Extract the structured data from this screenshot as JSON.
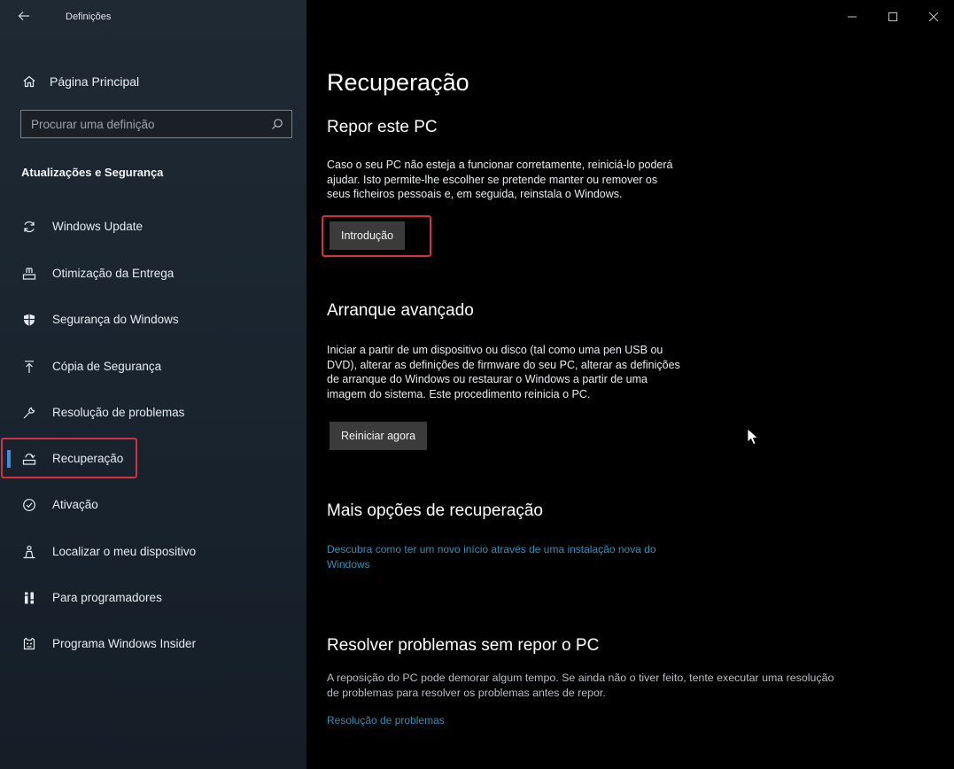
{
  "window": {
    "title": "Definições",
    "back_icon": "back-arrow-icon",
    "controls": [
      "minimize",
      "maximize",
      "close"
    ]
  },
  "sidebar": {
    "home_label": "Página Principal",
    "home_icon": "home-icon",
    "search": {
      "placeholder": "Procurar uma definição",
      "icon": "search-icon"
    },
    "section_title": "Atualizações e Segurança",
    "items": [
      {
        "label": "Windows Update",
        "icon": "sync-icon"
      },
      {
        "label": "Otimização da Entrega",
        "icon": "delivery-optimization-icon"
      },
      {
        "label": "Segurança do Windows",
        "icon": "shield-icon"
      },
      {
        "label": "Cópia de Segurança",
        "icon": "backup-arrow-icon"
      },
      {
        "label": "Resolução de problemas",
        "icon": "wrench-icon"
      },
      {
        "label": "Recuperação",
        "icon": "recovery-icon",
        "selected": true
      },
      {
        "label": "Ativação",
        "icon": "check-circle-icon"
      },
      {
        "label": "Localizar o meu dispositivo",
        "icon": "person-locate-icon"
      },
      {
        "label": "Para programadores",
        "icon": "developer-tools-icon"
      },
      {
        "label": "Programa Windows Insider",
        "icon": "insider-cat-icon"
      }
    ]
  },
  "main": {
    "page_title": "Recuperação",
    "reset": {
      "heading": "Repor este PC",
      "lines": [
        "Caso o seu PC não esteja a funcionar corretamente, reiniciá-lo poderá",
        "ajudar. Isto permite-lhe escolher se pretende manter ou remover os",
        "seus ficheiros pessoais e, em seguida, reinstala o Windows."
      ],
      "button": "Introdução"
    },
    "advanced": {
      "heading": "Arranque avançado",
      "lines": [
        "Iniciar a partir de um dispositivo ou disco (tal como uma pen USB ou",
        "DVD), alterar as definições de firmware do seu PC, alterar as definições",
        "de arranque do Windows ou restaurar o Windows a partir de uma",
        "imagem do sistema. Este procedimento reinicia o PC."
      ],
      "button": "Reiniciar agora"
    },
    "more": {
      "heading": "Mais opções de recuperação",
      "link_lines": [
        "Descubra como ter um novo início através de uma instalação nova do",
        "Windows"
      ]
    },
    "troubleshoot": {
      "heading": "Resolver problemas sem repor o PC",
      "lines": [
        "A reposição do PC pode demorar algum tempo. Se ainda não o tiver feito, tente executar uma resolução",
        "de problemas para resolver os problemas antes de repor."
      ],
      "link": "Resolução de problemas"
    }
  },
  "colors": {
    "accent": "#3a8fe0",
    "highlight": "#d6313e",
    "link": "#3fb3e8",
    "button": "#3b3b3b"
  }
}
